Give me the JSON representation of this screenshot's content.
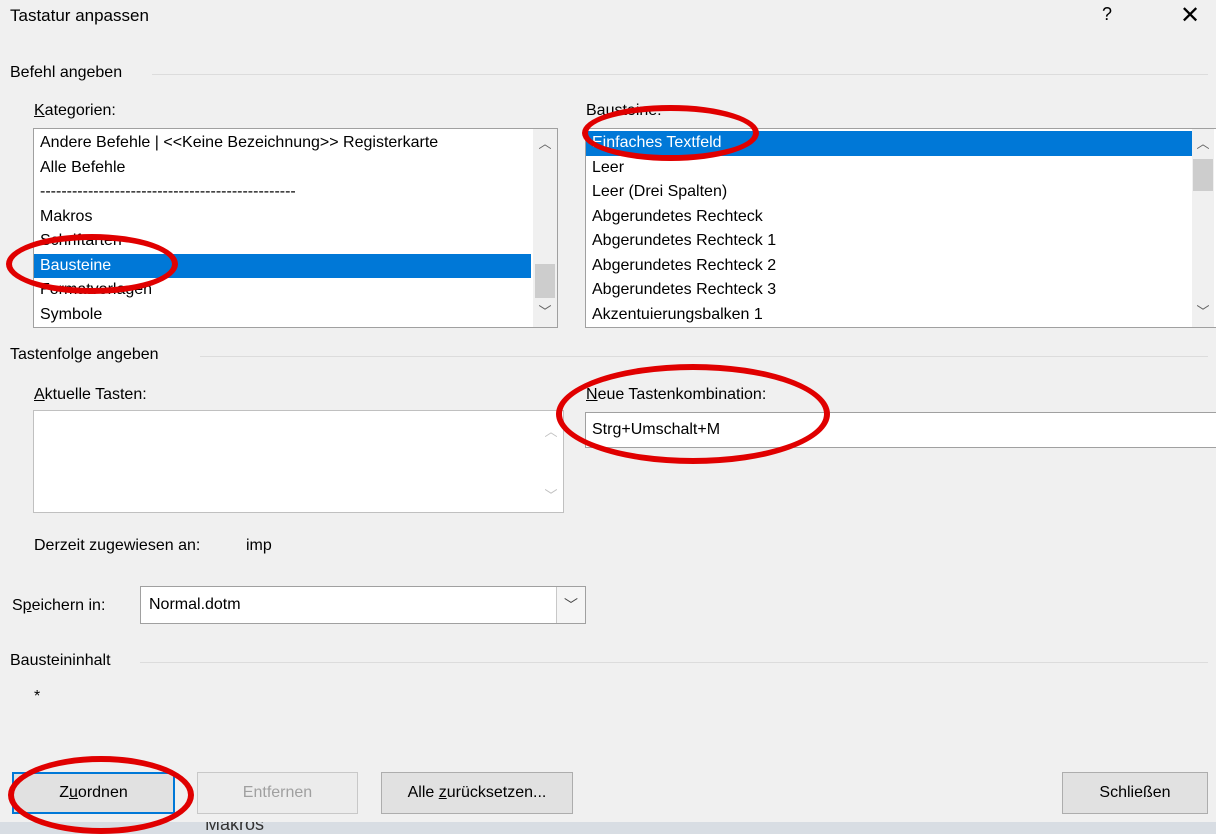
{
  "window": {
    "title": "Tastatur anpassen",
    "help_glyph": "?",
    "close_glyph": "✕"
  },
  "command_group": {
    "label": "Befehl angeben",
    "categories": {
      "label_hotkey": "K",
      "label_rest": "ategorien:",
      "items": [
        "Andere Befehle | <<Keine Bezeichnung>> Registerkarte",
        "Alle Befehle",
        "------------------------------------------------",
        "Makros",
        "Schriftarten",
        "Bausteine",
        "Formatvorlagen",
        "Symbole"
      ],
      "selected_index": 5
    },
    "building_blocks": {
      "label": "Bausteine:",
      "items": [
        "Einfaches Textfeld",
        "Leer",
        "Leer (Drei Spalten)",
        "Abgerundetes Rechteck",
        "Abgerundetes Rechteck 1",
        "Abgerundetes Rechteck 2",
        "Abgerundetes Rechteck 3",
        "Akzentuierungsbalken 1"
      ],
      "selected_index": 0
    }
  },
  "keys_group": {
    "label": "Tastenfolge angeben",
    "current_keys_label_hotkey": "A",
    "current_keys_label_rest": "ktuelle Tasten:",
    "new_combo_label_hotkey": "N",
    "new_combo_label_rest": "eue Tastenkombination:",
    "new_combo_value": "Strg+Umschalt+M",
    "assigned_label": "Derzeit zugewiesen an:",
    "assigned_value": "imp"
  },
  "save_in": {
    "label_pre": "S",
    "label_hotkey": "p",
    "label_rest": "eichern in:",
    "value": "Normal.dotm"
  },
  "content": {
    "label": "Bausteininhalt",
    "value": "*"
  },
  "buttons": {
    "assign_pre": "Z",
    "assign_hotkey": "u",
    "assign_rest": "ordnen",
    "remove": "Entfernen",
    "reset_pre": "Alle ",
    "reset_hotkey": "z",
    "reset_rest": "urücksetzen...",
    "close": "Schließen"
  },
  "background_text": "Makros",
  "colors": {
    "selection": "#0078d7",
    "annotation": "#e00000",
    "dialog_bg": "#f0f0f0"
  }
}
